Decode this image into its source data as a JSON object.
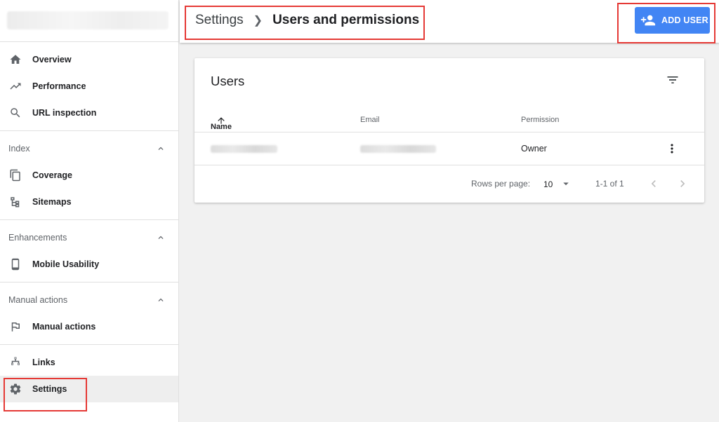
{
  "breadcrumb": {
    "parent": "Settings",
    "current": "Users and permissions"
  },
  "header": {
    "add_user_label": "ADD USER",
    "accent": "#4285f4"
  },
  "sidebar": {
    "top_items": [
      {
        "label": "Overview",
        "icon": "home-icon"
      },
      {
        "label": "Performance",
        "icon": "trending-up-icon"
      },
      {
        "label": "URL inspection",
        "icon": "search-icon"
      }
    ],
    "sections": [
      {
        "title": "Index",
        "items": [
          {
            "label": "Coverage",
            "icon": "coverage-icon"
          },
          {
            "label": "Sitemaps",
            "icon": "sitemap-icon"
          }
        ]
      },
      {
        "title": "Enhancements",
        "items": [
          {
            "label": "Mobile Usability",
            "icon": "mobile-icon"
          }
        ]
      },
      {
        "title": "Manual actions",
        "items": [
          {
            "label": "Manual actions",
            "icon": "flag-icon"
          }
        ]
      }
    ],
    "bottom_items": [
      {
        "label": "Links",
        "icon": "links-icon"
      },
      {
        "label": "Settings",
        "icon": "gear-icon",
        "active": true
      }
    ]
  },
  "users_card": {
    "title": "Users",
    "columns": {
      "name": "Name",
      "email": "Email",
      "permission": "Permission"
    },
    "rows": [
      {
        "permission": "Owner"
      }
    ],
    "pagination": {
      "rows_per_page_label": "Rows per page:",
      "rows_per_page_value": "10",
      "range": "1-1 of 1"
    }
  },
  "highlight_color": "#e53935"
}
